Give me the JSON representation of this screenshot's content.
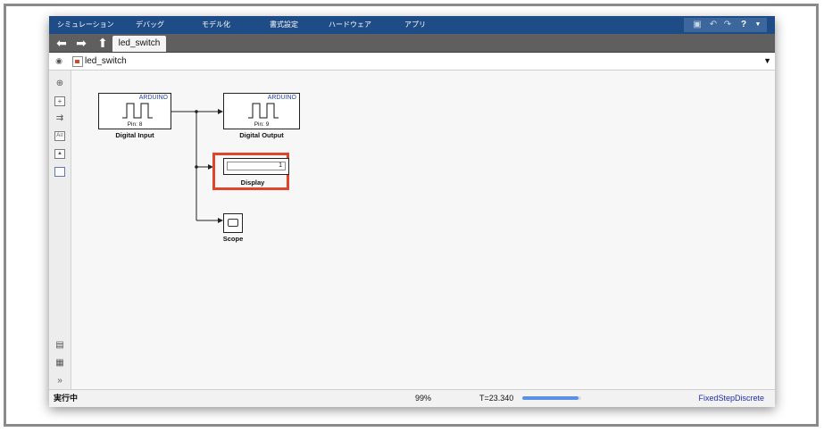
{
  "menubar": {
    "items": [
      "シミュレーション",
      "デバッグ",
      "モデル化",
      "書式設定",
      "ハードウェア",
      "アプリ"
    ],
    "quick_access_icons": [
      "save-icon",
      "undo-icon",
      "redo-icon",
      "help-icon",
      "dropdown-icon"
    ]
  },
  "navbar": {
    "buttons": [
      "back-arrow-icon",
      "forward-arrow-icon",
      "up-arrow-icon"
    ],
    "tab_label": "led_switch"
  },
  "address": {
    "model_name": "led_switch"
  },
  "toolbar": {
    "icons": [
      "zoom-icon",
      "fit-view-icon",
      "arrow-icon",
      "annotation-icon",
      "image-icon",
      "area-icon",
      "screenshot-icon",
      "property-inspector-icon",
      "expand-icon"
    ]
  },
  "blocks": {
    "digital_input": {
      "hardware": "ARDUINO",
      "pin": "Pin: 8",
      "name": "Digital Input"
    },
    "digital_output": {
      "hardware": "ARDUINO",
      "pin": "Pin: 9",
      "name": "Digital Output"
    },
    "display": {
      "value": "1",
      "name": "Display"
    },
    "scope": {
      "name": "Scope"
    }
  },
  "status": {
    "state": "実行中",
    "zoom": "99%",
    "time": "T=23.340",
    "progress_fraction": 0.95,
    "solver": "FixedStepDiscrete"
  },
  "colors": {
    "menubar": "#1d4c86",
    "highlight": "#e0452a",
    "progress": "#5c8fe6",
    "hardware_label": "#1e3fb3"
  }
}
